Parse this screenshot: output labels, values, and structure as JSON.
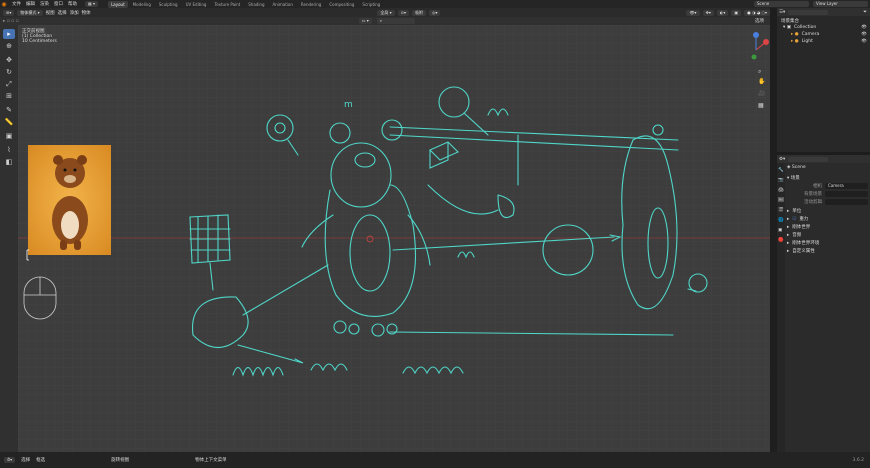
{
  "menu": [
    "文件",
    "编辑",
    "渲染",
    "窗口",
    "帮助"
  ],
  "workspace_tabs": [
    "Layout",
    "Modeling",
    "Sculpting",
    "UV Editing",
    "Texture Paint",
    "Shading",
    "Animation",
    "Rendering",
    "Compositing",
    "Scripting"
  ],
  "active_tab": "Layout",
  "topbar": {
    "scene": "Scene",
    "view_layer": "View Layer"
  },
  "viewport_header": {
    "mode": "物体模式",
    "view": "视图",
    "select": "选择",
    "add": "添加",
    "object": "物体",
    "transform": "全局",
    "snap": "吸附"
  },
  "viewport_header2": {
    "options": "选项"
  },
  "overlay_text": [
    "正交前视图",
    "(1) Collection",
    "10 Centimeters"
  ],
  "outliner": {
    "title": "场景集合",
    "items": [
      {
        "label": "Collection",
        "indent": 0
      },
      {
        "label": "Camera",
        "indent": 1
      },
      {
        "label": "Light",
        "indent": 1
      }
    ]
  },
  "props": {
    "scene": "Scene",
    "section_scene": "场景",
    "rows": [
      {
        "label": "相机",
        "value": "Camera"
      },
      {
        "label": "背景场景",
        "value": ""
      },
      {
        "label": "活动剪辑",
        "value": ""
      }
    ],
    "panels": [
      "单位",
      "重力",
      "刚体世界",
      "音频",
      "刚体世界环境",
      "自定义属性"
    ],
    "gravity_checked": true
  },
  "statusbar": {
    "items": [
      "选择",
      "框选",
      "旋转视图",
      "物体上下文菜单"
    ],
    "version": "3.6.2"
  },
  "sketch_labels": {
    "bone": "m"
  },
  "colors": {
    "accent": "#4772b3",
    "sketch": "#4fd6c8",
    "bg": "#3d3d3d"
  }
}
